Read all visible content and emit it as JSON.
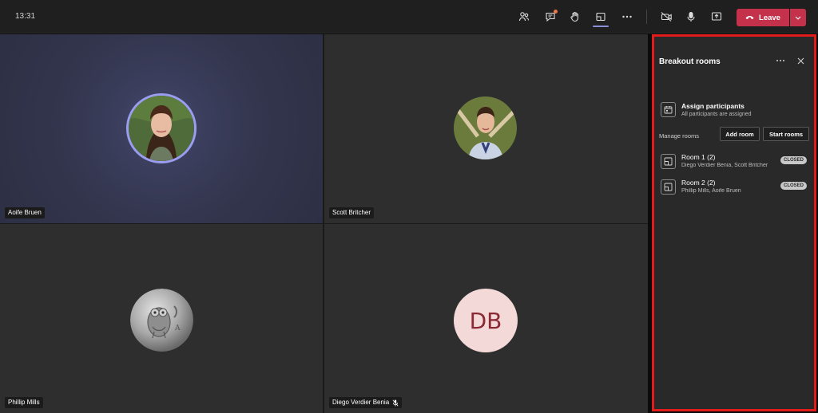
{
  "topbar": {
    "time": "13:31",
    "leave_label": "Leave",
    "icons": [
      "participants-icon",
      "chat-icon",
      "raise-hand-icon",
      "breakout-rooms-icon",
      "more-icon",
      "camera-off-icon",
      "microphone-icon",
      "share-screen-icon"
    ]
  },
  "participants": [
    {
      "name": "Aoife Bruen",
      "avatar": "photo"
    },
    {
      "name": "Scott Britcher",
      "avatar": "photo"
    },
    {
      "name": "Phillip Mills",
      "avatar": "coin-image"
    },
    {
      "name": "Diego Verdier Benia",
      "initials": "DB",
      "muted": true
    }
  ],
  "panel": {
    "title": "Breakout rooms",
    "assign": {
      "title": "Assign participants",
      "subtitle": "All participants are assigned"
    },
    "manage_label": "Manage rooms",
    "add_room_label": "Add room",
    "start_rooms_label": "Start rooms",
    "rooms": [
      {
        "name": "Room 1 (2)",
        "members": "Diego Verdier Benia, Scott Britcher",
        "status": "CLOSED"
      },
      {
        "name": "Room 2 (2)",
        "members": "Phillip Mills, Aoife Bruen",
        "status": "CLOSED"
      }
    ]
  },
  "colors": {
    "accent": "#8b8cd8",
    "leave": "#c4314b",
    "highlight_border": "#e21b1b",
    "initials_bg": "#f4d9d9",
    "initials_text": "#8b2a35"
  }
}
